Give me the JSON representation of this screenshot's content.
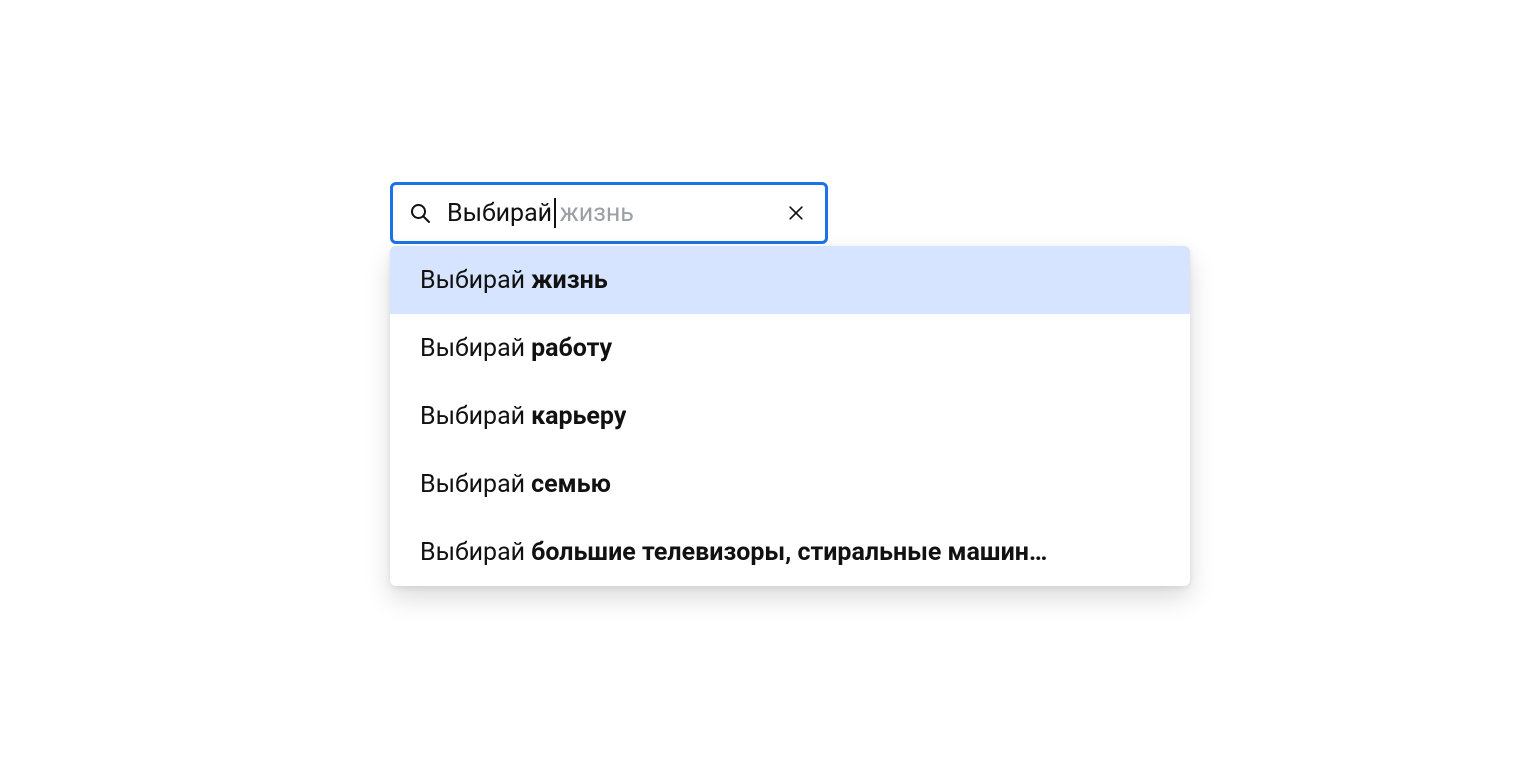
{
  "search": {
    "value": "Выбирай",
    "hint": "жизнь"
  },
  "suggestions": [
    {
      "prefix": "Выбирай",
      "bold": "жизнь",
      "active": true
    },
    {
      "prefix": "Выбирай",
      "bold": "работу",
      "active": false
    },
    {
      "prefix": "Выбирай",
      "bold": "карьеру",
      "active": false
    },
    {
      "prefix": "Выбирай",
      "bold": "семью",
      "active": false
    },
    {
      "prefix": "Выбирай",
      "bold": "большие телевизоры, стиральные машин…",
      "active": false
    }
  ],
  "colors": {
    "focus_border": "#1a73e8",
    "hint_text": "#9aa0a6",
    "active_bg": "#d6e4ff"
  }
}
